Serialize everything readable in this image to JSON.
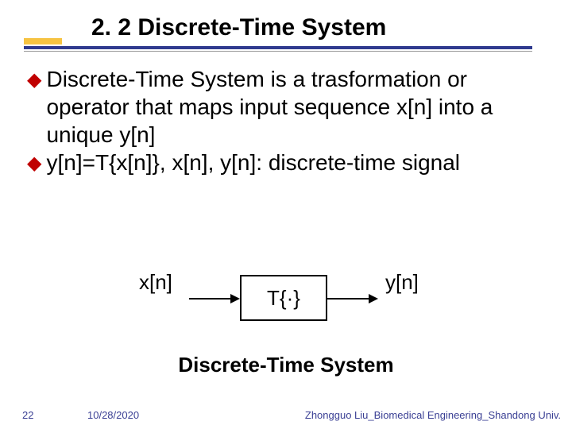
{
  "title": "2. 2 Discrete-Time System",
  "bullets": [
    {
      "mark": "◆",
      "text": "Discrete-Time System is a trasformation or operator that maps input sequence x[n] into a unique y[n]"
    },
    {
      "mark": "◆",
      "text": "y[n]=T{x[n]}, x[n], y[n]: discrete-time signal"
    }
  ],
  "diagram": {
    "input": "x[n]",
    "box": "T{·}",
    "output": "y[n]"
  },
  "caption": "Discrete-Time System",
  "footer": {
    "page": "22",
    "date": "10/28/2020",
    "author": "Zhongguo Liu_Biomedical Engineering_Shandong Univ."
  }
}
